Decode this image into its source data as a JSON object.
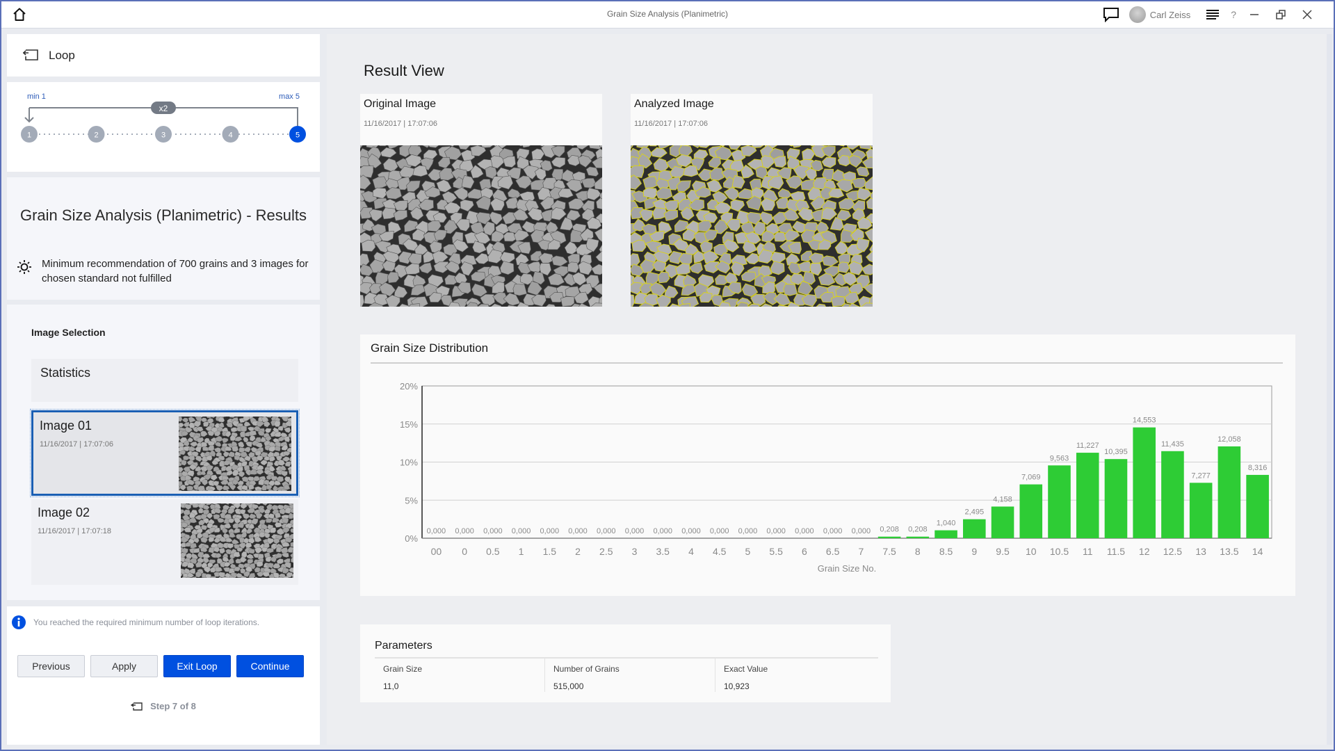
{
  "titlebar": {
    "title": "Grain Size Analysis (Planimetric)",
    "user_name": "Carl Zeiss",
    "help_label": "?"
  },
  "left_panel": {
    "loop_label": "Loop",
    "loop_diagram": {
      "min_label": "min 1",
      "max_label": "max 5",
      "repeat_badge": "x2",
      "steps": [
        "1",
        "2",
        "3",
        "4",
        "5"
      ],
      "active_step": 5,
      "colors": {
        "inactive": "#a3abb8",
        "active": "#0050e0",
        "line": "#7d838c"
      }
    },
    "results_title": "Grain Size Analysis (Planimetric) - Results",
    "warning_text": "Minimum recommendation of 700 grains and 3 images for chosen standard not fulfilled",
    "image_selection": {
      "heading": "Image Selection",
      "statistics_label": "Statistics",
      "images": [
        {
          "name": "Image 01",
          "timestamp": "11/16/2017 | 17:07:06",
          "selected": true
        },
        {
          "name": "Image 02",
          "timestamp": "11/16/2017 | 17:07:18",
          "selected": false
        }
      ]
    },
    "info_message": "You reached the required minimum number of loop iterations.",
    "buttons": {
      "previous": "Previous",
      "apply": "Apply",
      "exit_loop": "Exit Loop",
      "continue": "Continue"
    },
    "step_indicator": "Step 7 of 8"
  },
  "main": {
    "title": "Result View",
    "original_image": {
      "title": "Original Image",
      "timestamp": "11/16/2017 | 17:07:06"
    },
    "analyzed_image": {
      "title": "Analyzed Image",
      "timestamp": "11/16/2017 | 17:07:06"
    },
    "chart_title": "Grain Size Distribution",
    "parameters": {
      "title": "Parameters",
      "columns": [
        {
          "header": "Grain Size",
          "value": "11,0"
        },
        {
          "header": "Number of Grains",
          "value": "515,000"
        },
        {
          "header": "Exact Value",
          "value": "10,923"
        }
      ]
    }
  },
  "colors": {
    "accent": "#0050e0",
    "bar": "#2ecc35",
    "selection_border": "#1a5fb4"
  },
  "chart_data": {
    "type": "bar",
    "title": "Grain Size Distribution",
    "xlabel": "Grain Size No.",
    "ylabel": "",
    "ylim": [
      0,
      20
    ],
    "yticks": [
      0,
      5,
      10,
      15,
      20
    ],
    "ytick_labels": [
      "0%",
      "5%",
      "10%",
      "15%",
      "20%"
    ],
    "grid": true,
    "categories": [
      "00",
      "0",
      "0.5",
      "1",
      "1.5",
      "2",
      "2.5",
      "3",
      "3.5",
      "4",
      "4.5",
      "5",
      "5.5",
      "6",
      "6.5",
      "7",
      "7.5",
      "8",
      "8.5",
      "9",
      "9.5",
      "10",
      "10.5",
      "11",
      "11.5",
      "12",
      "12.5",
      "13",
      "13.5",
      "14"
    ],
    "values": [
      0,
      0,
      0,
      0,
      0,
      0,
      0,
      0,
      0,
      0,
      0,
      0,
      0,
      0,
      0,
      0,
      0.208,
      0.208,
      1.04,
      2.495,
      4.158,
      7.069,
      9.563,
      11.227,
      10.395,
      14.553,
      11.435,
      7.277,
      12.058,
      8.316
    ],
    "value_labels": [
      "0,000",
      "0,000",
      "0,000",
      "0,000",
      "0,000",
      "0,000",
      "0,000",
      "0,000",
      "0,000",
      "0,000",
      "0,000",
      "0,000",
      "0,000",
      "0,000",
      "0,000",
      "0,000",
      "0,208",
      "0,208",
      "1,040",
      "2,495",
      "4,158",
      "7,069",
      "9,563",
      "11,227",
      "10,395",
      "14,553",
      "11,435",
      "7,277",
      "12,058",
      "8,316"
    ]
  }
}
